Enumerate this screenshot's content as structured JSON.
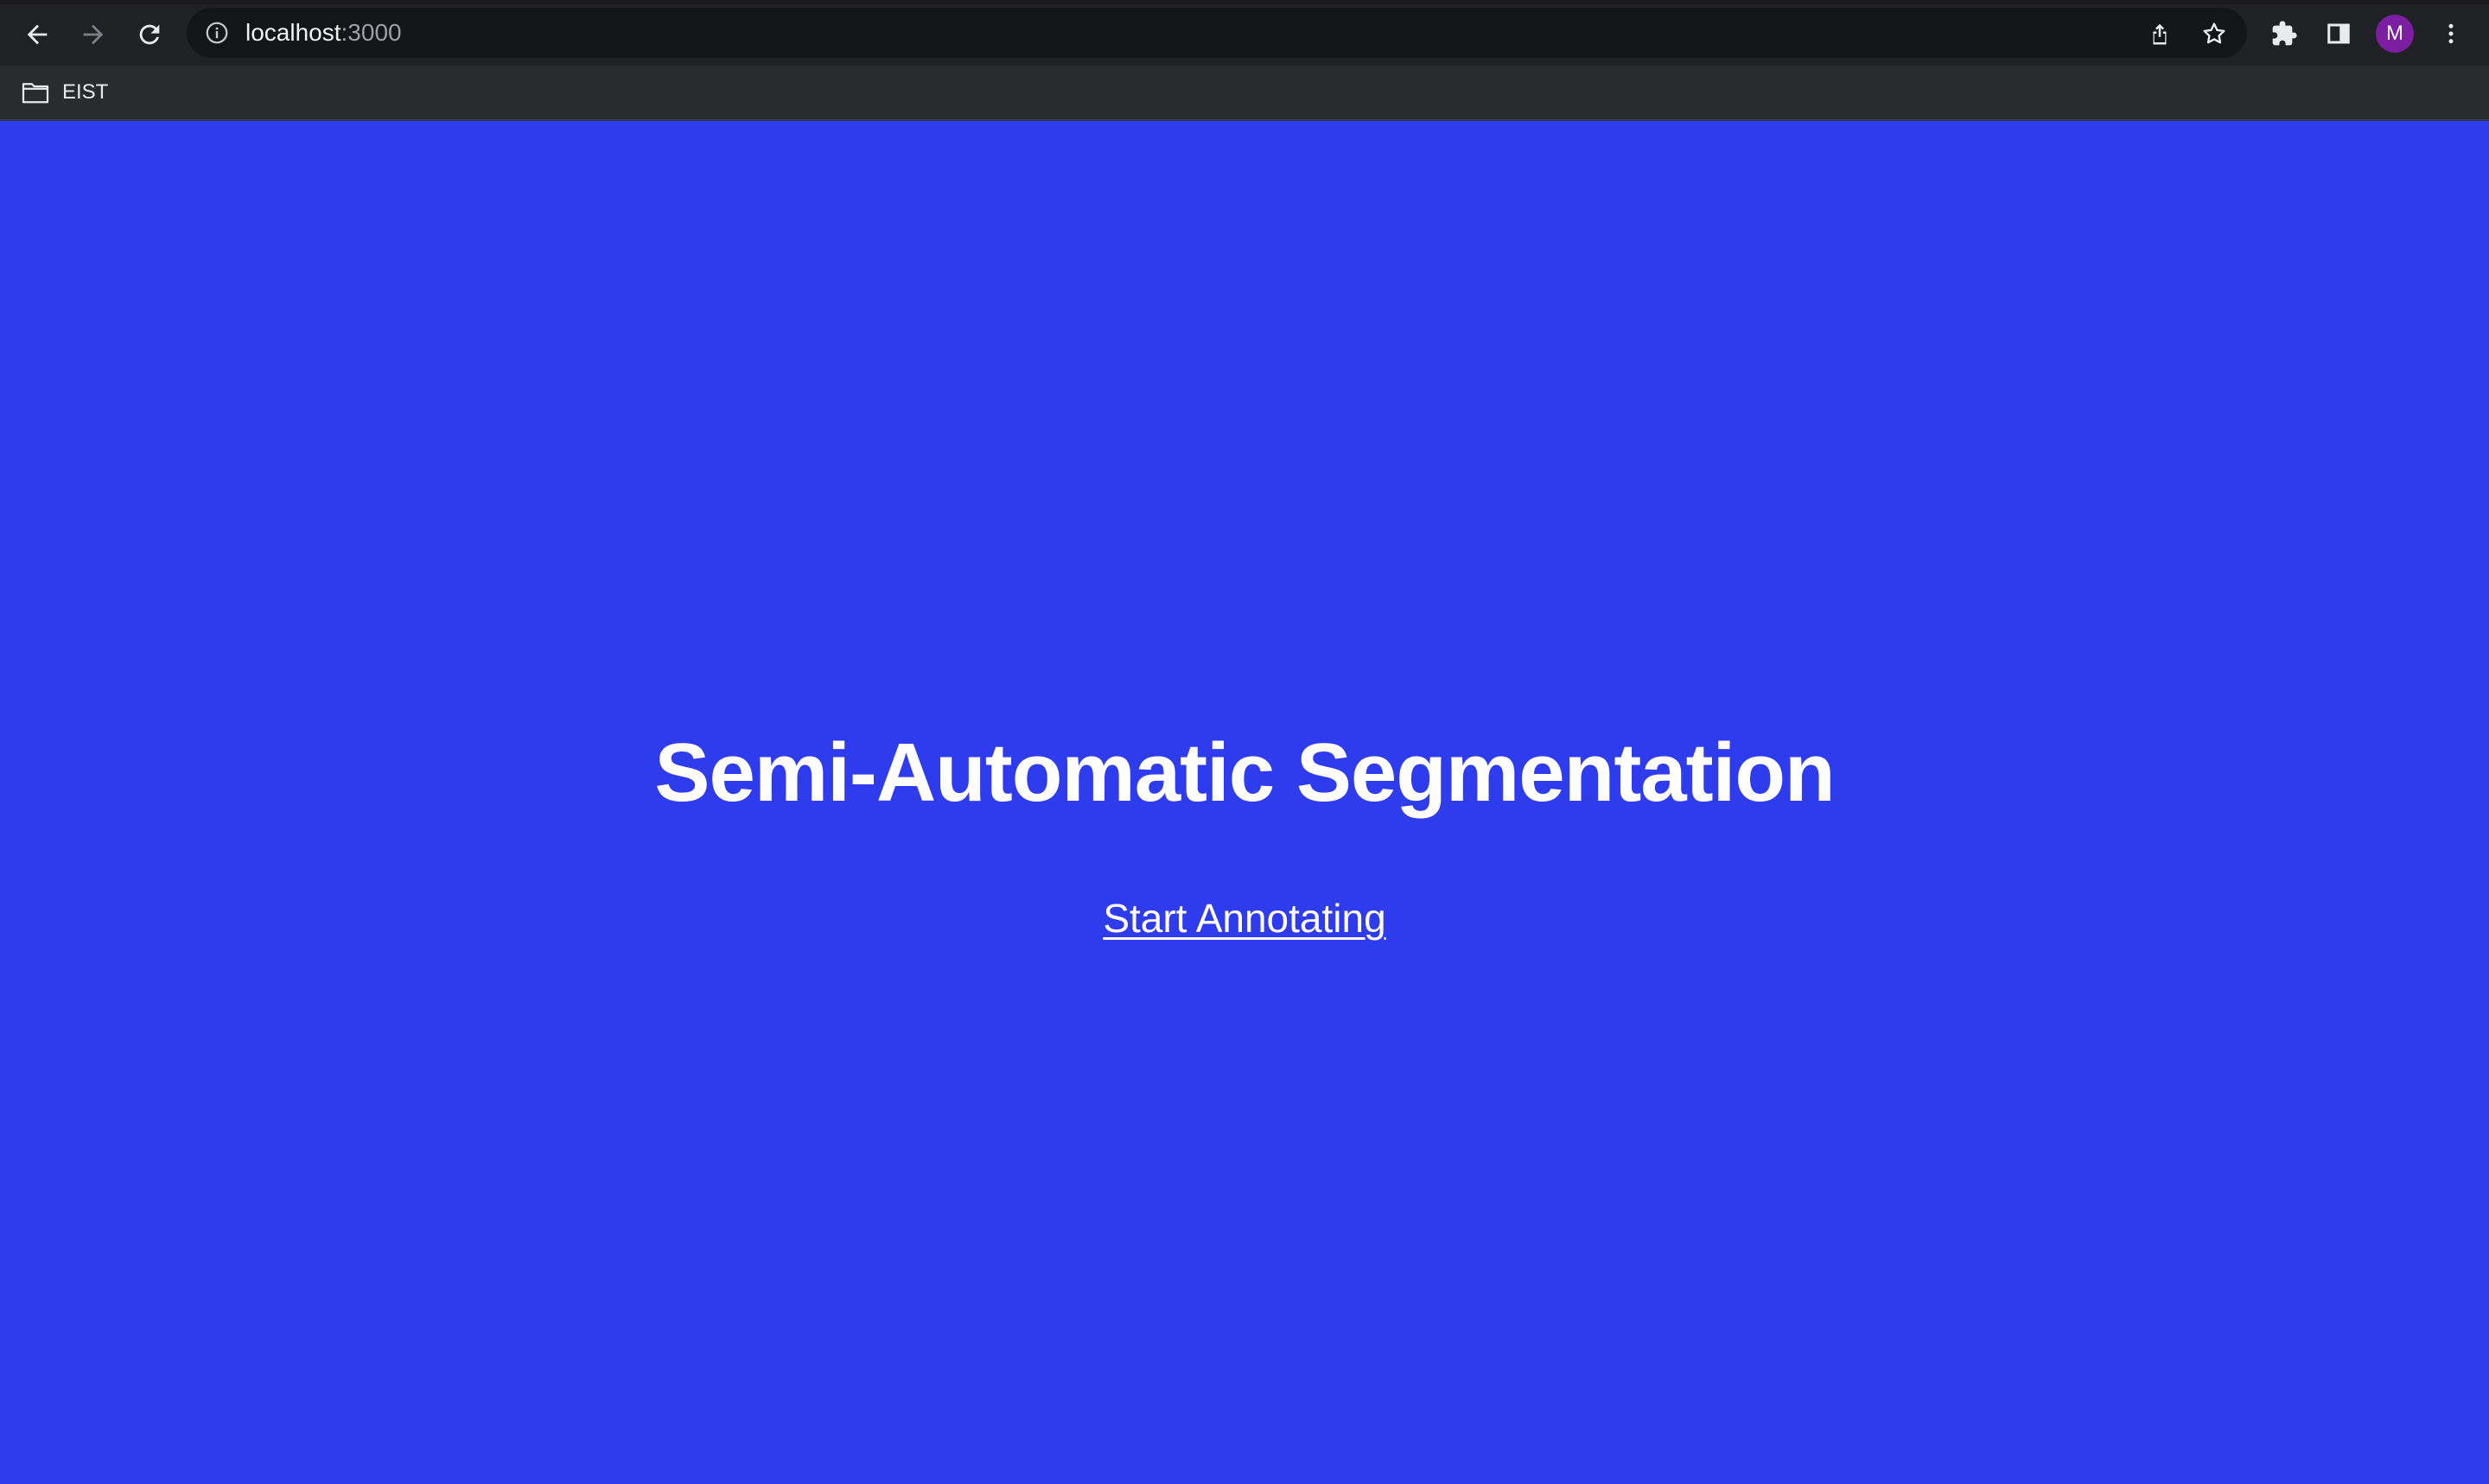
{
  "browser": {
    "url_host": "localhost",
    "url_port": ":3000",
    "profile_initial": "M",
    "bookmarks": [
      {
        "label": "EIST",
        "icon": "folder-icon"
      }
    ],
    "icons": {
      "back": "back-arrow-icon",
      "forward": "forward-arrow-icon",
      "reload": "reload-icon",
      "site_info": "info-icon",
      "share": "share-icon",
      "bookmark_star": "star-icon",
      "extensions": "puzzle-icon",
      "side_panel": "side-panel-icon",
      "menu": "kebab-menu-icon"
    }
  },
  "page": {
    "title": "Semi-Automatic Segmentation",
    "cta_label": "Start Annotating",
    "background_color": "#2e3ced"
  }
}
